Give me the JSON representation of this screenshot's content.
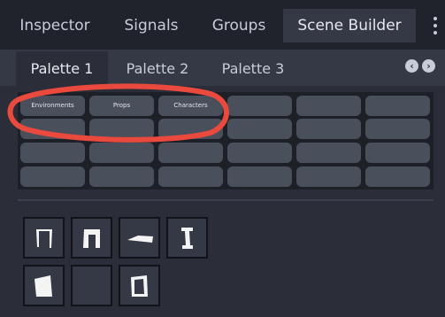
{
  "top_tabs": [
    "Inspector",
    "Signals",
    "Groups",
    "Scene Builder"
  ],
  "active_top_tab": "Scene Builder",
  "palette_tabs": [
    "Palette 1",
    "Palette 2",
    "Palette 3"
  ],
  "active_palette_tab": "Palette 1",
  "nav": {
    "prev_icon": "chevron-left-icon",
    "next_icon": "chevron-right-icon"
  },
  "grid_buttons": {
    "row1": [
      "Environments",
      "Props",
      "Characters",
      "",
      "",
      ""
    ]
  },
  "thumbnails": [
    {
      "icon": "doorway-icon"
    },
    {
      "icon": "archway-icon"
    },
    {
      "icon": "floor-tile-icon"
    },
    {
      "icon": "pillar-icon"
    },
    {
      "icon": "wall-panel-icon"
    },
    {
      "icon": "empty-slot"
    },
    {
      "icon": "door-frame-icon"
    }
  ],
  "colors": {
    "background": "#2b2e38",
    "topbar": "#20232b",
    "active_tab": "#353946",
    "button": "#4a4f5c",
    "annotation": "#ea4a3e"
  }
}
